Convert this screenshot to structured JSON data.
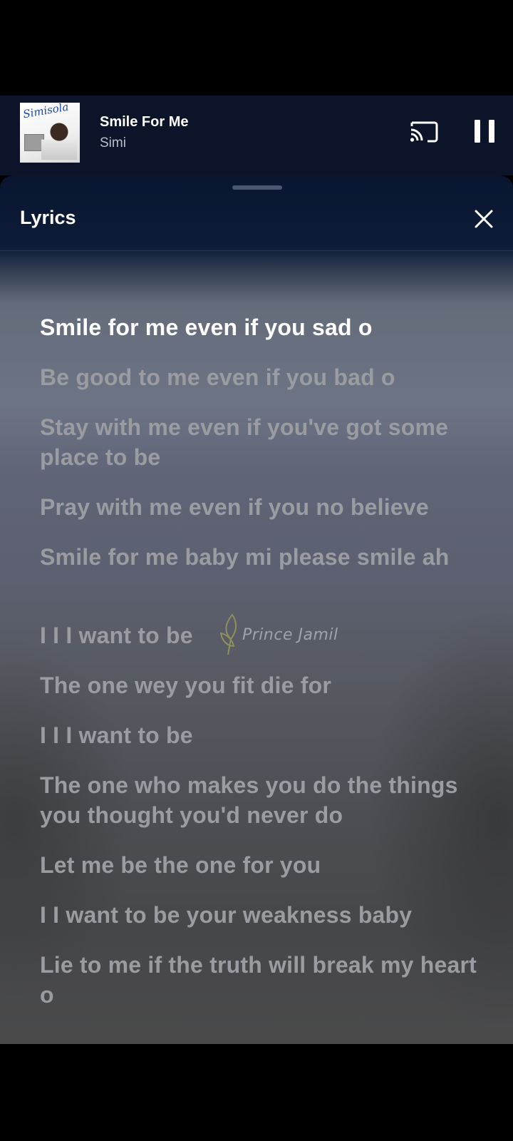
{
  "mini_player": {
    "album_art_text": "Simisola",
    "title": "Smile For Me",
    "artist": "Simi",
    "cast_icon": "cast-icon",
    "pause_icon": "pause-icon"
  },
  "lyrics_sheet": {
    "title": "Lyrics",
    "close_icon": "close-icon",
    "lines": [
      "Smile for me even if you sad o",
      "Be good to me even if you bad o",
      "Stay with me even if you've got some place to be",
      "Pray with me even if you no believe",
      "Smile for me baby mi please smile ah",
      "I I I want to be",
      "The one wey you fit die for",
      "I I I want to be",
      "The one who makes you do the things you thought you'd never do",
      "Let me be the one for you",
      "I I want to be your weakness baby",
      "Lie to me if the truth will break my heart o"
    ],
    "active_line_index": 0
  },
  "watermark": {
    "text": "Prince Jamil"
  },
  "colors": {
    "active_lyric": "#ffffff",
    "inactive_lyric": "#9a9ca2",
    "header_bg": "#0b1428"
  }
}
